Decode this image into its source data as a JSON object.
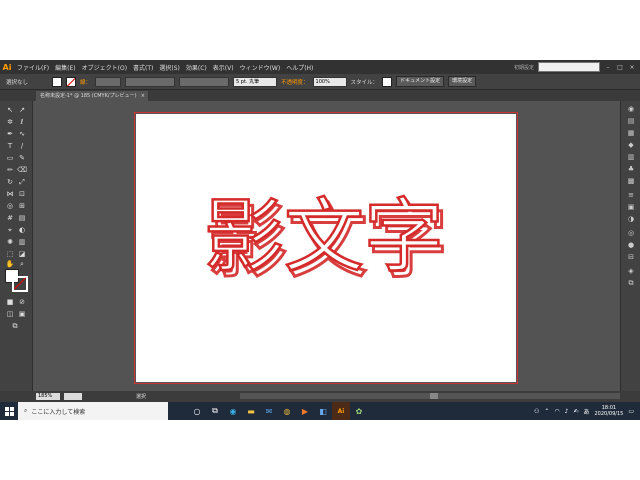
{
  "menubar": {
    "app_logo": "Ai",
    "items": [
      "ファイル(F)",
      "編集(E)",
      "オブジェクト(O)",
      "書式(T)",
      "選択(S)",
      "効果(C)",
      "表示(V)",
      "ウィンドウ(W)",
      "ヘルプ(H)"
    ],
    "workspace": "初期設定"
  },
  "control": {
    "selection_label": "選択なし",
    "stroke_label": "線：",
    "stroke_weight": "5 pt. 丸筆",
    "opacity_label": "不透明度：",
    "opacity_value": "100%",
    "style_label": "スタイル：",
    "doc_setup": "ドキュメント設定",
    "preferences": "環境設定"
  },
  "document": {
    "tab_title": "名称未設定-1* @ 185 (CMYK/プレビュー)",
    "artwork_text": "影文字",
    "text_color": "#d42a2a"
  },
  "status": {
    "zoom": "185%",
    "tool": "選択"
  },
  "taskbar": {
    "search_placeholder": "ここに入力して検索",
    "time": "18:01",
    "date": "2020/09/15",
    "ime": "あ"
  }
}
